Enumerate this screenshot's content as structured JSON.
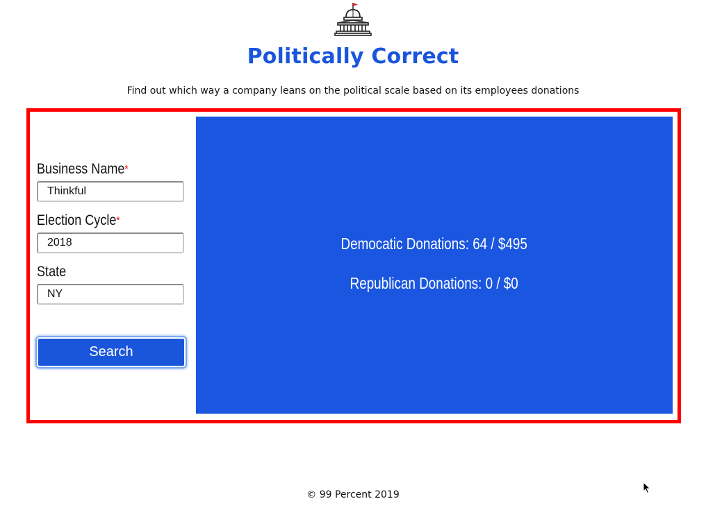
{
  "header": {
    "logo_icon": "capitol-building-icon",
    "title": "Politically Correct",
    "subtitle": "Find out which way a company leans on the political scale based on its employees donations"
  },
  "form": {
    "business_name": {
      "label": "Business Name",
      "required_mark": "*",
      "value": "Thinkful"
    },
    "election_cycle": {
      "label": "Election Cycle",
      "required_mark": "*",
      "value": "2018"
    },
    "state": {
      "label": "State",
      "value": "NY"
    },
    "search_label": "Search"
  },
  "results": {
    "democratic": "Democatic Donations: 64 / $495",
    "republican": "Republican Donations: 0 / $0"
  },
  "footer": {
    "copyright": "© 99 Percent 2019"
  },
  "colors": {
    "brand_blue": "#1a56db",
    "frame_red": "#ff0000",
    "results_bg": "#1a56e0"
  }
}
